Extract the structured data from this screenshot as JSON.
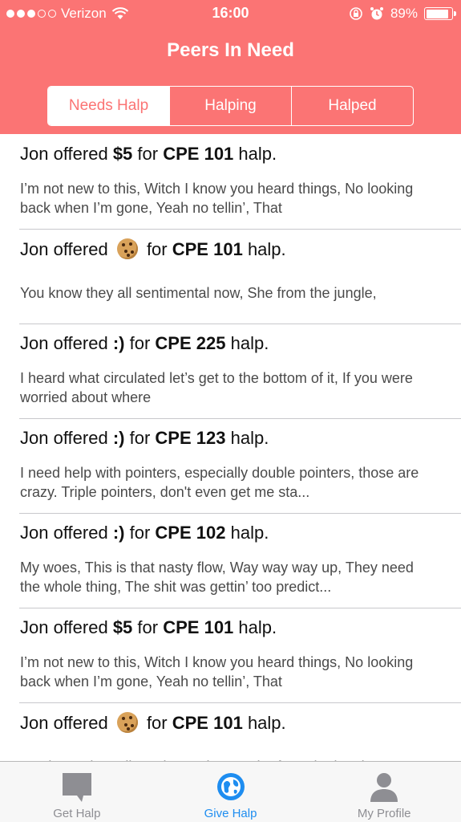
{
  "status_bar": {
    "carrier": "Verizon",
    "time": "16:00",
    "battery": "89%",
    "battery_level": 0.89
  },
  "nav": {
    "title": "Peers In Need"
  },
  "segments": [
    {
      "label": "Needs Halp",
      "selected": true
    },
    {
      "label": "Halping",
      "selected": false
    },
    {
      "label": "Halped",
      "selected": false
    }
  ],
  "requests": [
    {
      "prefix": "Jon offered",
      "offer": "$5",
      "mid": "for",
      "course": "CPE 101",
      "suffix": "halp.",
      "offer_is_cookie": false,
      "description": "I’m not new to this, Witch I know you heard things, No looking back when I’m gone, Yeah no tellin’, That"
    },
    {
      "prefix": "Jon offered",
      "offer": "",
      "mid": "for",
      "course": "CPE 101",
      "suffix": "halp.",
      "offer_is_cookie": true,
      "description": "You know they all sentimental now, She from the jungle,"
    },
    {
      "prefix": "Jon offered",
      "offer": ":)",
      "mid": "for",
      "course": "CPE 225",
      "suffix": "halp.",
      "offer_is_cookie": false,
      "description": "I heard what circulated let’s get to the bottom of it, If you were worried about where"
    },
    {
      "prefix": "Jon offered",
      "offer": ":)",
      "mid": "for",
      "course": "CPE 123",
      "suffix": "halp.",
      "offer_is_cookie": false,
      "description": "I need help with pointers, especially double pointers, those are crazy. Triple pointers, don't even get me sta..."
    },
    {
      "prefix": "Jon offered",
      "offer": ":)",
      "mid": "for",
      "course": "CPE 102",
      "suffix": "halp.",
      "offer_is_cookie": false,
      "description": "My woes, This is that nasty flow, Way way way up, They need the whole thing, The shit was gettin’ too predict..."
    },
    {
      "prefix": "Jon offered",
      "offer": "$5",
      "mid": "for",
      "course": "CPE 101",
      "suffix": "halp.",
      "offer_is_cookie": false,
      "description": "I’m not new to this, Witch I know you heard things, No looking back when I’m gone, Yeah no tellin’, That"
    },
    {
      "prefix": "Jon offered",
      "offer": "",
      "mid": "for",
      "course": "CPE 101",
      "suffix": "halp.",
      "offer_is_cookie": true,
      "description": "You know they all sentimental now, She from the jungle,"
    }
  ],
  "tabbar": {
    "items": [
      {
        "label": "Get Halp",
        "icon": "speech-bubble-icon",
        "active": false
      },
      {
        "label": "Give Halp",
        "icon": "globe-icon",
        "active": true
      },
      {
        "label": "My Profile",
        "icon": "person-icon",
        "active": false
      }
    ]
  },
  "colors": {
    "header": "#fb7474",
    "tab_active": "#1e8df0",
    "tab_inactive": "#8e8e93"
  }
}
